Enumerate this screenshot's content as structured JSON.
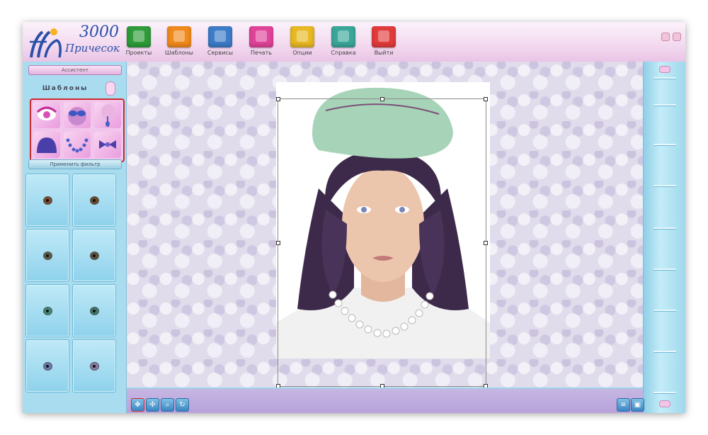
{
  "app": {
    "logo_number": "3000",
    "logo_text": "Причесок"
  },
  "toolbar": {
    "items": [
      {
        "label": "Проекты",
        "icon": "projects-icon",
        "color": "#2f9b3a"
      },
      {
        "label": "Шаблоны",
        "icon": "templates-icon",
        "color": "#f08a1d"
      },
      {
        "label": "Сервисы",
        "icon": "services-icon",
        "color": "#3d7cc8"
      },
      {
        "label": "Печать",
        "icon": "print-icon",
        "color": "#e0439a"
      },
      {
        "label": "Опции",
        "icon": "options-icon",
        "color": "#e8b923"
      },
      {
        "label": "Справка",
        "icon": "help-icon",
        "color": "#3aa79a"
      },
      {
        "label": "Выйти",
        "icon": "exit-icon",
        "color": "#e23b3b"
      }
    ]
  },
  "left_panel": {
    "assistant_label": "Ассистент",
    "templates_title": "Шаблоны",
    "apply_filter_label": "Применить фильтр",
    "template_icons": [
      "eye-makeup-icon",
      "glasses-icon",
      "earring-icon",
      "hat-icon",
      "necklace-icon",
      "bow-tie-icon"
    ],
    "eye_colors": [
      "#7a4a2a",
      "#6a4a2a",
      "#5a5a4a",
      "#5c5040",
      "#3f8a78",
      "#3a7a6a",
      "#6a7ab0",
      "#8a7aa8"
    ]
  },
  "bottom_tools": [
    "move-icon",
    "pan-icon",
    "zoom-icon",
    "rotate-icon"
  ],
  "bottom_right_tools": [
    "list-view-icon",
    "image-view-icon"
  ]
}
